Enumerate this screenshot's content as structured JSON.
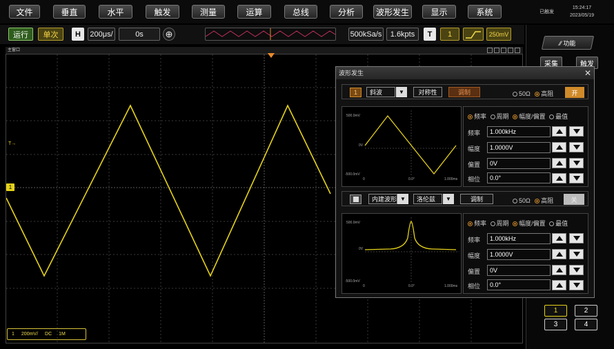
{
  "menu": [
    {
      "label": "文件"
    },
    {
      "label": "垂直"
    },
    {
      "label": "水平"
    },
    {
      "label": "触发"
    },
    {
      "label": "测量"
    },
    {
      "label": "运算"
    },
    {
      "label": "总线"
    },
    {
      "label": "分析"
    },
    {
      "label": "波形发生"
    },
    {
      "label": "显示"
    },
    {
      "label": "系统"
    }
  ],
  "status": {
    "trigger_state": "已触发",
    "time": "15:24:17",
    "date": "2023/05/19"
  },
  "toolbar": {
    "run": "运行",
    "single": "单次",
    "h": "H",
    "timebase": "200μs/",
    "delay": "0s",
    "sample_rate": "500kSa/s",
    "mem_depth": "1.6kpts",
    "t": "T",
    "trig_ch": "1",
    "trig_level": "250mV"
  },
  "plot": {
    "window_title": "主窗口",
    "trigger_marker": "T",
    "ch1_marker": "1"
  },
  "ch1_info": {
    "ch": "1",
    "scale": "200mV/",
    "coupling": "DC",
    "impedance": "1M"
  },
  "right_panel": {
    "function_label": "功能",
    "buttons": [
      "采集",
      "触发"
    ],
    "channels": [
      "1",
      "2",
      "3",
      "4"
    ]
  },
  "dialog": {
    "title": "波形发生",
    "gen1": {
      "index": "1",
      "wave": "斜波",
      "sym_label": "对称性",
      "mod_label": "调制",
      "r50": "50Ω",
      "rhigh": "高阻",
      "onoff": "开",
      "mode_freq": "频率",
      "mode_period": "周期",
      "mode_amp": "幅度/偏置",
      "mode_peak": "最值",
      "params": [
        {
          "label": "频率",
          "value": "1.000kHz"
        },
        {
          "label": "幅度",
          "value": "1.0000V"
        },
        {
          "label": "偏置",
          "value": "0V"
        },
        {
          "label": "相位",
          "value": "0.0°"
        }
      ],
      "plot": {
        "ytop": "500.0mV",
        "ymid": "0V",
        "ybot": "-500.0mV",
        "x0": "0",
        "xmid": "0.0°",
        "xend": "1.000ms"
      }
    },
    "gen2": {
      "wave": "内建波形",
      "sub_wave": "洛伦兹",
      "mod_label": "调制",
      "r50": "50Ω",
      "rhigh": "高阻",
      "onoff": "关",
      "mode_freq": "频率",
      "mode_period": "周期",
      "mode_amp": "幅度/偏置",
      "mode_peak": "最值",
      "params": [
        {
          "label": "频率",
          "value": "1.000kHz"
        },
        {
          "label": "幅度",
          "value": "1.0000V"
        },
        {
          "label": "偏置",
          "value": "0V"
        },
        {
          "label": "相位",
          "value": "0.0°"
        }
      ],
      "plot": {
        "ytop": "500.0mV",
        "ymid": "0V",
        "ybot": "-500.0mV",
        "x0": "0",
        "xmid": "0.0°",
        "xend": "1.000ms"
      }
    }
  },
  "colors": {
    "ch1": "#e6d21a",
    "accent": "#d08a2a"
  }
}
